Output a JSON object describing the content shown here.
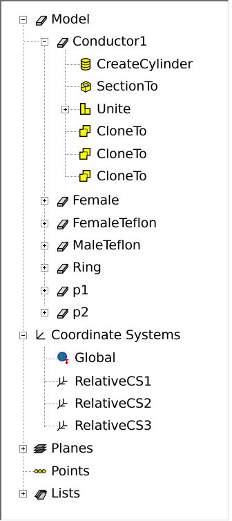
{
  "tree": {
    "model": {
      "label": "Model",
      "conductor1": {
        "label": "Conductor1",
        "children": [
          "CreateCylinder",
          "SectionTo",
          "Unite",
          "CloneTo",
          "CloneTo",
          "CloneTo"
        ]
      },
      "parts": [
        "Female",
        "FemaleTeflon",
        "MaleTeflon",
        "Ring",
        "p1",
        "p2"
      ]
    },
    "coordinate_systems": {
      "label": "Coordinate Systems",
      "children": [
        "Global",
        "RelativeCS1",
        "RelativeCS2",
        "RelativeCS3"
      ]
    },
    "planes": {
      "label": "Planes"
    },
    "points": {
      "label": "Points"
    },
    "lists": {
      "label": "Lists"
    }
  },
  "icons": {
    "model": "solid-box-icon",
    "conductor": "solid-box-icon",
    "create_cylinder": "cylinder-icon",
    "section_to": "section-icon",
    "unite": "unite-icon",
    "clone_to": "clone-icon",
    "parts": "solid-box-icon",
    "coordinate_systems": "axes-icon",
    "global": "globe-icon",
    "relative_cs": "relative-cs-icon",
    "planes": "planes-icon",
    "points": "points-icon",
    "lists": "lists-icon"
  },
  "colors": {
    "icon_yellow": "#ffff00",
    "tree_line": "#8a8a8a",
    "box_face": "#d4d0c8"
  }
}
